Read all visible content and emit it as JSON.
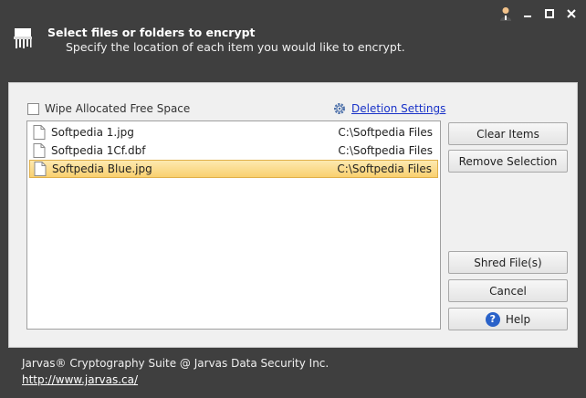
{
  "header": {
    "title": "Select files or folders to encrypt",
    "subtitle": "Specify the location of each item you would like to encrypt."
  },
  "window_controls": {
    "user_icon": "user-icon",
    "minimize": "–",
    "maximize": "◻",
    "close": "✕"
  },
  "options": {
    "wipe_label": "Wipe Allocated Free Space",
    "wipe_checked": false,
    "deletion_settings_label": "Deletion Settings"
  },
  "files": [
    {
      "name": "Softpedia 1.jpg",
      "path": "C:\\Softpedia Files",
      "selected": false
    },
    {
      "name": "Softpedia 1Cf.dbf",
      "path": "C:\\Softpedia Files",
      "selected": false
    },
    {
      "name": "Softpedia Blue.jpg",
      "path": "C:\\Softpedia Files",
      "selected": true
    }
  ],
  "buttons": {
    "clear_items": "Clear Items",
    "remove_selection": "Remove Selection",
    "shred_files": "Shred File(s)",
    "cancel": "Cancel",
    "help": "Help"
  },
  "footer": {
    "copyright": "Jarvas® Cryptography Suite @ Jarvas Data Security Inc.",
    "url": "http://www.jarvas.ca/"
  },
  "colors": {
    "background": "#3f3f3f",
    "panel": "#f0f0f0",
    "selection": "#f9d06f",
    "link": "#1a33c8"
  }
}
